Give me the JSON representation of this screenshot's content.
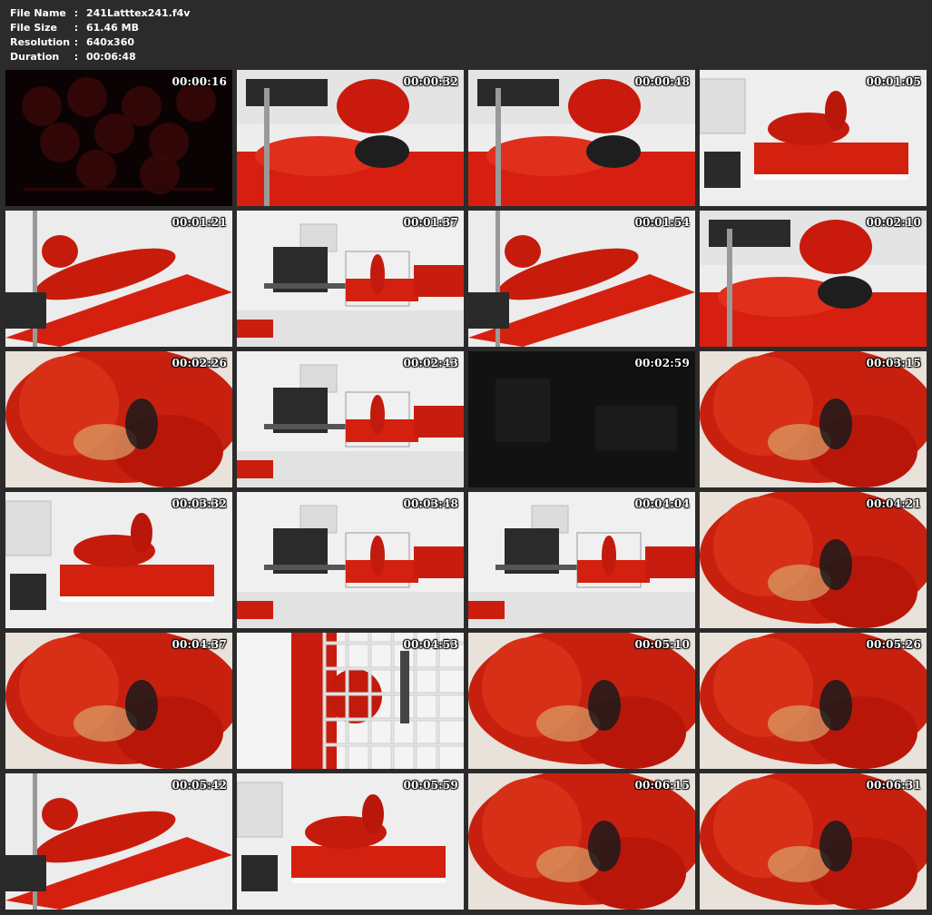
{
  "file_info": [
    {
      "label": "File Name",
      "sep": ":",
      "value": "241Latttex241.f4v"
    },
    {
      "label": "File Size",
      "sep": ":",
      "value": "61.46 MB"
    },
    {
      "label": "Resolution",
      "sep": ":",
      "value": "640x360"
    },
    {
      "label": "Duration",
      "sep": ":",
      "value": "00:06:48"
    }
  ],
  "thumbnails": [
    {
      "time": "00:00:16",
      "scene": "dark"
    },
    {
      "time": "00:00:32",
      "scene": "closeup-bed"
    },
    {
      "time": "00:00:48",
      "scene": "closeup-bed"
    },
    {
      "time": "00:01:05",
      "scene": "room-bed"
    },
    {
      "time": "00:01:21",
      "scene": "bed-diagonal"
    },
    {
      "time": "00:01:37",
      "scene": "room-wide"
    },
    {
      "time": "00:01:54",
      "scene": "bed-diagonal"
    },
    {
      "time": "00:02:10",
      "scene": "closeup-bed"
    },
    {
      "time": "00:02:26",
      "scene": "closeup-red"
    },
    {
      "time": "00:02:43",
      "scene": "room-wide"
    },
    {
      "time": "00:02:59",
      "scene": "dark-room"
    },
    {
      "time": "00:03:15",
      "scene": "closeup-red"
    },
    {
      "time": "00:03:32",
      "scene": "room-bed"
    },
    {
      "time": "00:03:48",
      "scene": "room-wide"
    },
    {
      "time": "00:04:04",
      "scene": "room-wide"
    },
    {
      "time": "00:04:21",
      "scene": "closeup-red"
    },
    {
      "time": "00:04:37",
      "scene": "closeup-red"
    },
    {
      "time": "00:04:53",
      "scene": "cage"
    },
    {
      "time": "00:05:10",
      "scene": "closeup-red"
    },
    {
      "time": "00:05:26",
      "scene": "closeup-red"
    },
    {
      "time": "00:05:42",
      "scene": "bed-diagonal"
    },
    {
      "time": "00:05:59",
      "scene": "room-bed"
    },
    {
      "time": "00:06:15",
      "scene": "closeup-red"
    },
    {
      "time": "00:06:31",
      "scene": "closeup-red"
    }
  ]
}
